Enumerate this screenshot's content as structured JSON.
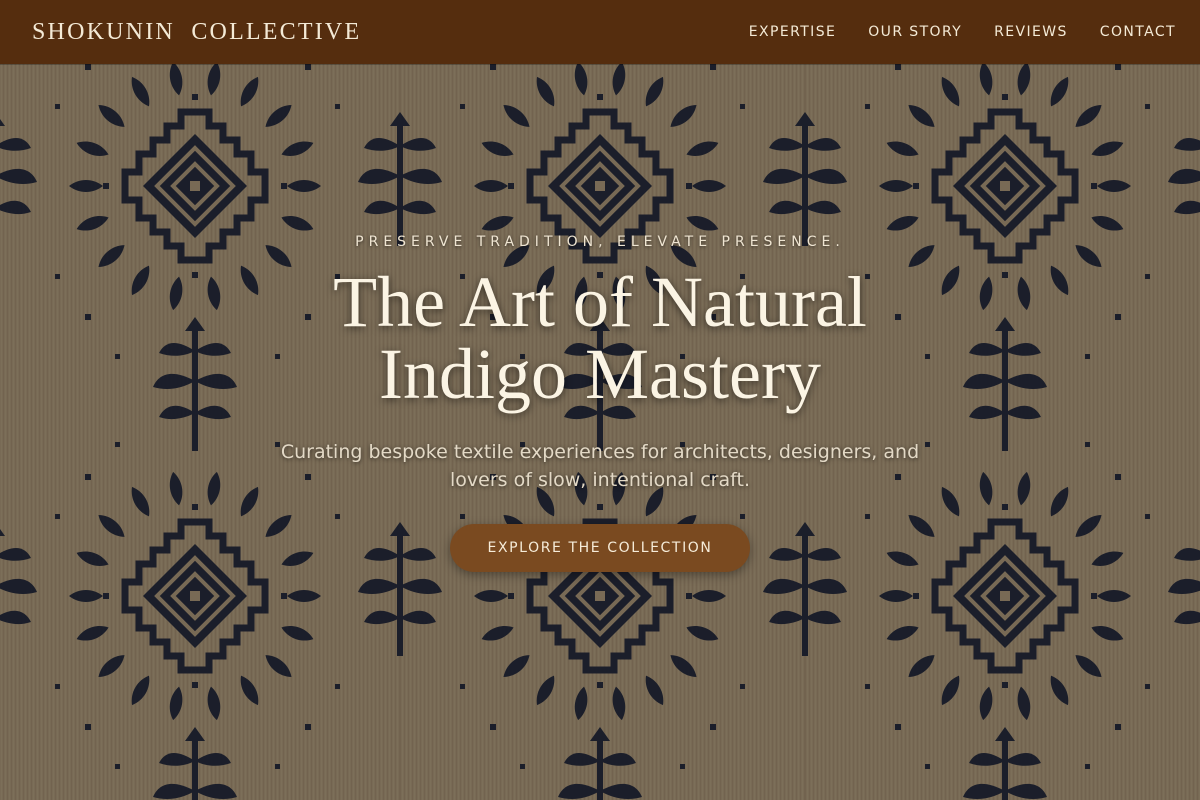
{
  "brand": {
    "name": "SHOKUNIN  COLLECTIVE"
  },
  "nav": {
    "items": [
      {
        "label": "EXPERTISE"
      },
      {
        "label": "OUR STORY"
      },
      {
        "label": "REVIEWS"
      },
      {
        "label": "CONTACT"
      }
    ]
  },
  "hero": {
    "eyebrow": "PRESERVE TRADITION, ELEVATE PRESENCE.",
    "headline": "The Art of Natural Indigo Mastery",
    "subhead": "Curating bespoke textile experiences for architects, designers, and lovers of slow, intentional craft.",
    "cta_label": "EXPLORE THE COLLECTION",
    "background_description_icon": "indigo-textile-pattern"
  },
  "colors": {
    "header_bg": "#552d0e",
    "cta_bg": "#7a4a20",
    "text_light": "#f4ead6",
    "indigo": "#1c2233",
    "linen": "#8a7a62"
  }
}
